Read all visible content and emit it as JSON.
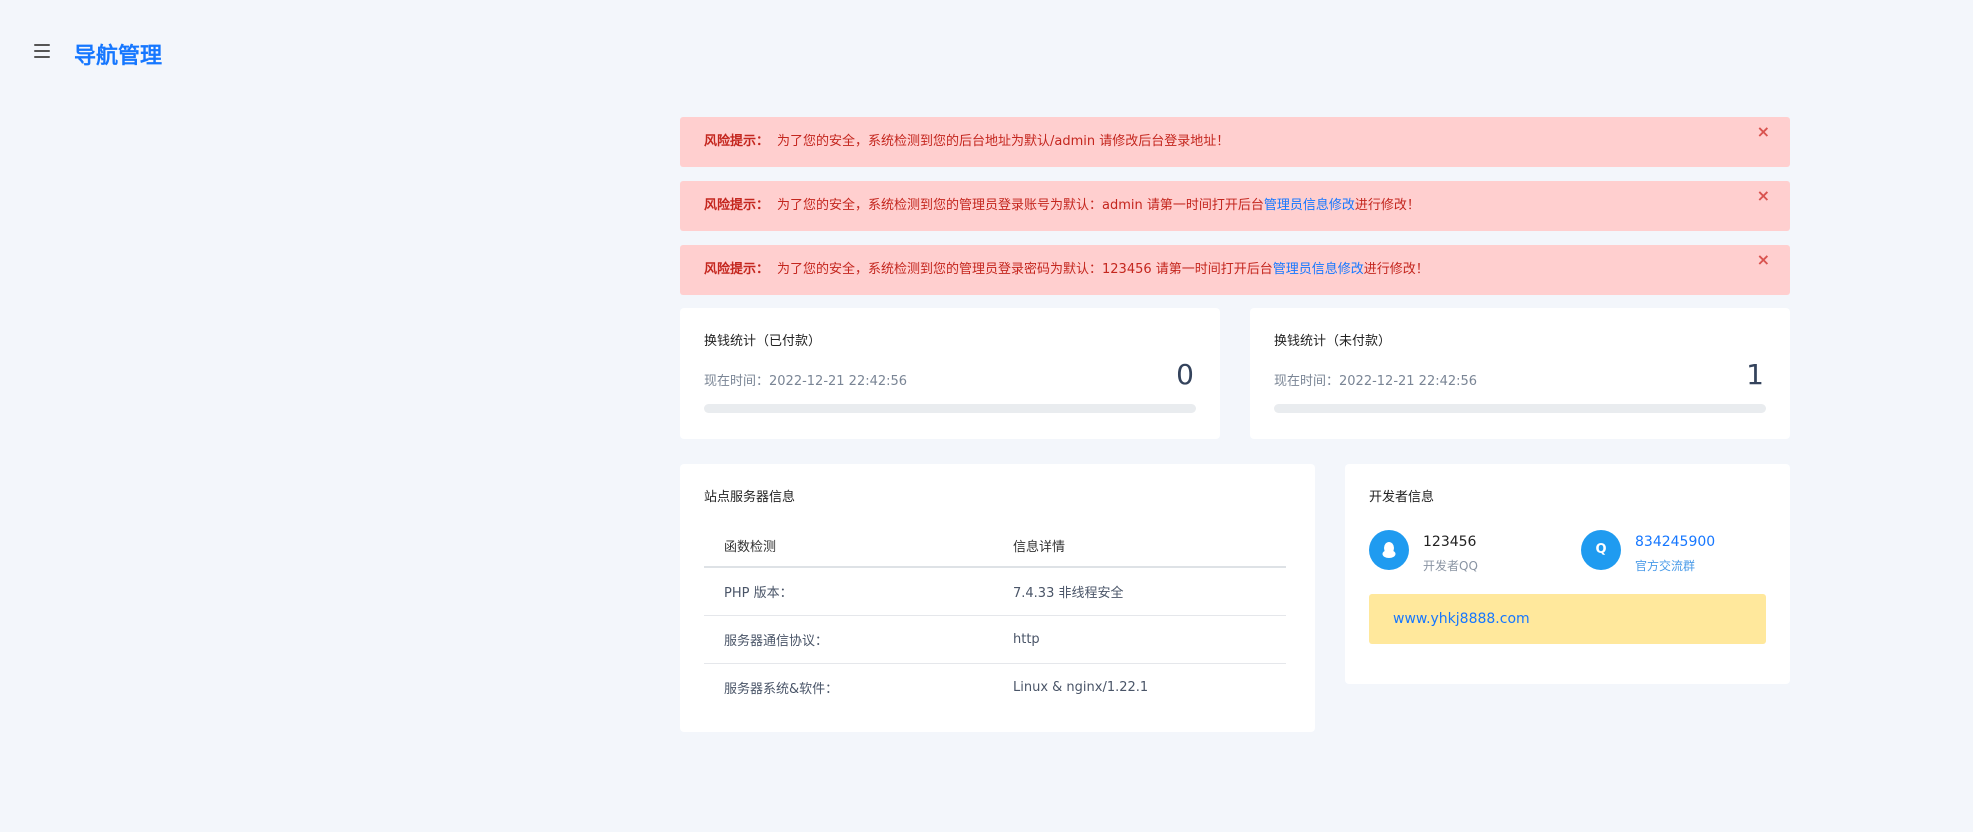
{
  "header": {
    "menu_icon": "hamburger-menu-icon",
    "title": "导航管理"
  },
  "alerts": [
    {
      "lead": "风险提示：",
      "text": "为了您的安全，系统检测到您的后台地址为默认/admin 请修改后台登录地址！",
      "link": "",
      "after": "",
      "close": "×"
    },
    {
      "lead": "风险提示：",
      "text": "为了您的安全，系统检测到您的管理员登录账号为默认：admin 请第一时间打开后台",
      "link": "管理员信息修改",
      "after": "进行修改！",
      "close": "×"
    },
    {
      "lead": "风险提示：",
      "text": "为了您的安全，系统检测到您的管理员登录密码为默认：123456 请第一时间打开后台",
      "link": "管理员信息修改",
      "after": "进行修改！",
      "close": "×"
    }
  ],
  "stats": {
    "paid": {
      "title": "换钱统计（已付款）",
      "time": "现在时间：2022-12-21 22:42:56",
      "count": "0",
      "progress": 0
    },
    "unpaid": {
      "title": "换钱统计（未付款）",
      "time": "现在时间：2022-12-21 22:42:56",
      "count": "1",
      "progress": 0
    }
  },
  "server": {
    "title": "站点服务器信息",
    "headers": [
      "函数检测",
      "信息详情"
    ],
    "rows": [
      [
        "PHP 版本：",
        "7.4.33 非线程安全"
      ],
      [
        "服务器通信协议：",
        "http"
      ],
      [
        "服务器系统&软件：",
        "Linux & nginx/1.22.1"
      ]
    ]
  },
  "developer": {
    "title": "开发者信息",
    "qq": {
      "icon": "qq-penguin-icon",
      "value": "123456",
      "label": "开发者QQ"
    },
    "group": {
      "icon": "q-group-icon",
      "glyph": "Q",
      "value": "834245900",
      "label": "官方交流群"
    },
    "site": "www.yhkj8888.com"
  },
  "colors": {
    "accent": "#1677ff",
    "alert_bg": "#ffcfcf",
    "alert_text": "#c4261e",
    "icon_bg": "#1f9bf0",
    "site_bg": "#ffe89c"
  }
}
